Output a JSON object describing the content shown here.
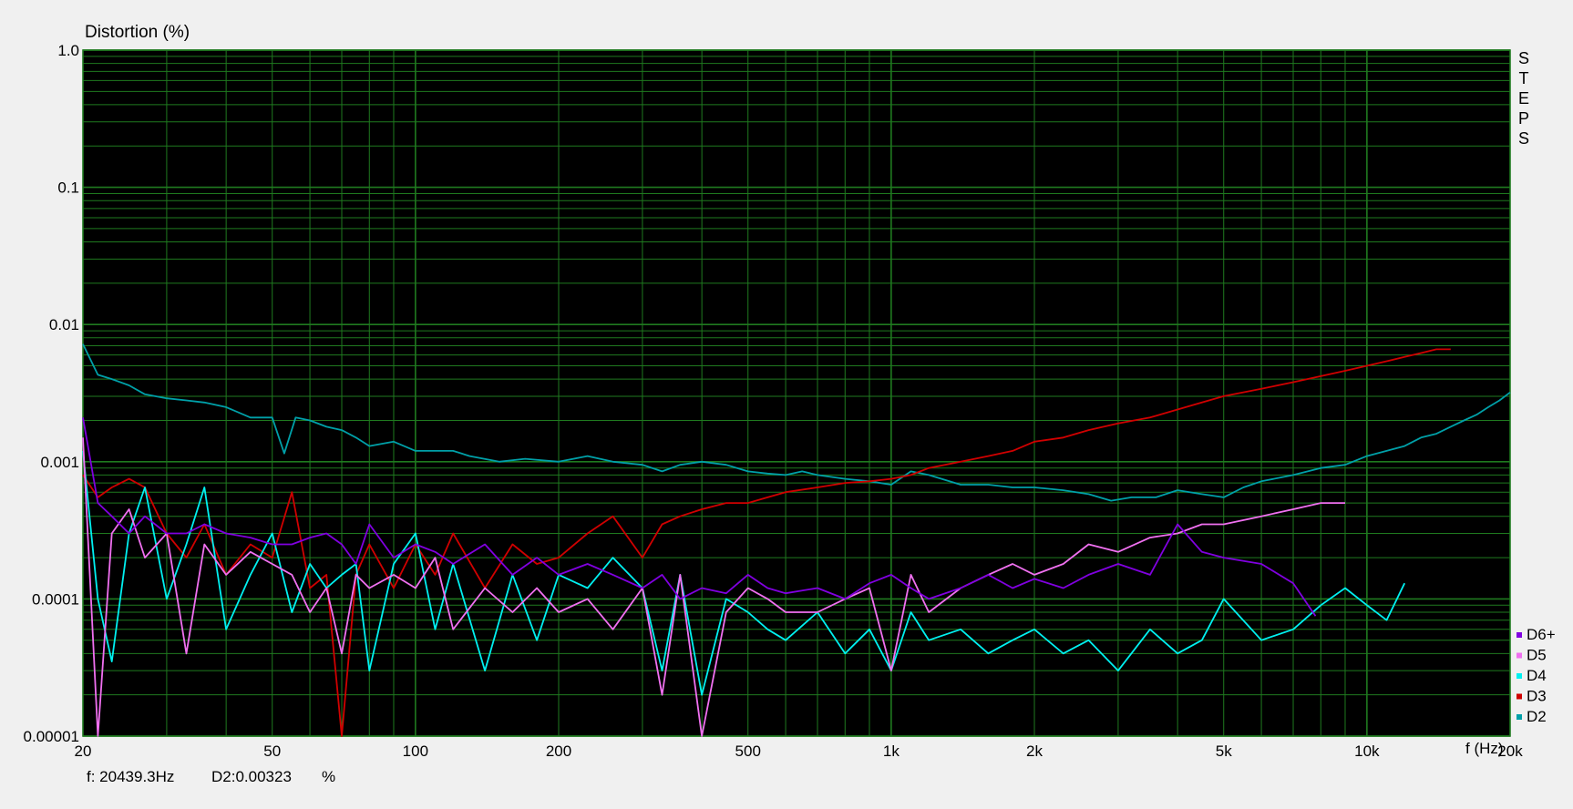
{
  "colors": {
    "plot_background": "#000000",
    "page_background": "#f0f0f0",
    "grid": "#1f7a1f",
    "D2": "#00a0a8",
    "D3": "#d00000",
    "D4": "#00f0f0",
    "D5": "#f070f0",
    "D6+": "#8000e0"
  },
  "chart_data": {
    "type": "line",
    "title": "",
    "ylabel": "Distortion (%)",
    "xlabel": "f (Hz)",
    "x_scale": "log",
    "y_scale": "log",
    "xlim": [
      20,
      20000
    ],
    "ylim": [
      1e-05,
      1.0
    ],
    "grid": true,
    "legend_placement": "right-bottom",
    "side_label": "STEPS",
    "x_ticks": [
      "20",
      "50",
      "100",
      "200",
      "500",
      "1k",
      "2k",
      "5k",
      "10k",
      "20k"
    ],
    "y_ticks": [
      "1.0",
      "0.1",
      "0.01",
      "0.001",
      "0.0001",
      "0.00001"
    ],
    "readout": {
      "frequency": "f: 20439.3Hz",
      "value": "D2:0.00323",
      "unit": "%"
    },
    "legend": [
      "D6+",
      "D5",
      "D4",
      "D3",
      "D2"
    ],
    "series": [
      {
        "name": "D2",
        "x": [
          20,
          21.5,
          23,
          25,
          27,
          30,
          33,
          36,
          40,
          45,
          50,
          53,
          56,
          60,
          65,
          70,
          75,
          80,
          90,
          100,
          110,
          120,
          130,
          150,
          170,
          200,
          230,
          260,
          300,
          330,
          360,
          400,
          450,
          500,
          550,
          600,
          650,
          700,
          800,
          900,
          1000,
          1100,
          1200,
          1400,
          1600,
          1800,
          2000,
          2300,
          2600,
          2900,
          3200,
          3600,
          4000,
          4500,
          5000,
          5500,
          6000,
          7000,
          8000,
          9000,
          10000,
          11000,
          12000,
          13000,
          14000,
          15000,
          16000,
          17000,
          18000,
          19000,
          20000
        ],
        "y": [
          0.0072,
          0.0043,
          0.004,
          0.0036,
          0.0031,
          0.0029,
          0.0028,
          0.0027,
          0.0025,
          0.0021,
          0.0021,
          0.00115,
          0.0021,
          0.002,
          0.0018,
          0.0017,
          0.0015,
          0.0013,
          0.0014,
          0.0012,
          0.0012,
          0.0012,
          0.0011,
          0.001,
          0.00105,
          0.001,
          0.0011,
          0.001,
          0.00095,
          0.00085,
          0.00095,
          0.001,
          0.00095,
          0.00085,
          0.00082,
          0.0008,
          0.00085,
          0.0008,
          0.00075,
          0.00072,
          0.00068,
          0.00085,
          0.0008,
          0.00068,
          0.00068,
          0.00065,
          0.00065,
          0.00062,
          0.00058,
          0.00052,
          0.00055,
          0.00055,
          0.00062,
          0.00058,
          0.00055,
          0.00065,
          0.00072,
          0.0008,
          0.0009,
          0.00095,
          0.0011,
          0.0012,
          0.0013,
          0.0015,
          0.0016,
          0.0018,
          0.002,
          0.0022,
          0.0025,
          0.0028,
          0.0032
        ]
      },
      {
        "name": "D3",
        "x": [
          20,
          21.5,
          23,
          25,
          27,
          30,
          33,
          36,
          40,
          45,
          50,
          55,
          60,
          65,
          70,
          75,
          80,
          90,
          100,
          110,
          120,
          140,
          160,
          180,
          200,
          230,
          260,
          300,
          330,
          360,
          400,
          450,
          500,
          550,
          600,
          700,
          800,
          900,
          1000,
          1100,
          1200,
          1400,
          1600,
          1800,
          2000,
          2300,
          2600,
          3000,
          3500,
          4000,
          4500,
          5000,
          6000,
          7000,
          8000,
          9000,
          10000,
          11000,
          12000,
          13000,
          14000,
          15000
        ],
        "y": [
          0.0008,
          0.00055,
          0.00065,
          0.00075,
          0.00065,
          0.0003,
          0.0002,
          0.00035,
          0.00015,
          0.00025,
          0.0002,
          0.0006,
          0.00012,
          0.00015,
          1e-05,
          0.00015,
          0.00025,
          0.00012,
          0.00025,
          0.00015,
          0.0003,
          0.00012,
          0.00025,
          0.00018,
          0.0002,
          0.0003,
          0.0004,
          0.0002,
          0.00035,
          0.0004,
          0.00045,
          0.0005,
          0.0005,
          0.00055,
          0.0006,
          0.00065,
          0.0007,
          0.00072,
          0.00075,
          0.0008,
          0.0009,
          0.001,
          0.0011,
          0.0012,
          0.0014,
          0.0015,
          0.0017,
          0.0019,
          0.0021,
          0.0024,
          0.0027,
          0.003,
          0.0034,
          0.0038,
          0.0042,
          0.0046,
          0.005,
          0.0054,
          0.0058,
          0.0062,
          0.0066,
          0.0066
        ]
      },
      {
        "name": "D4",
        "x": [
          20,
          21.5,
          23,
          25,
          27,
          30,
          33,
          36,
          40,
          45,
          50,
          55,
          60,
          65,
          70,
          75,
          80,
          90,
          100,
          110,
          120,
          140,
          160,
          180,
          200,
          230,
          260,
          300,
          330,
          360,
          400,
          450,
          500,
          550,
          600,
          700,
          800,
          900,
          1000,
          1100,
          1200,
          1400,
          1600,
          1800,
          2000,
          2300,
          2600,
          3000,
          3500,
          4000,
          4500,
          5000,
          6000,
          7000,
          8000,
          9000,
          10000,
          11000,
          12000
        ],
        "y": [
          0.0012,
          0.0001,
          3.5e-05,
          0.0003,
          0.00065,
          0.0001,
          0.00025,
          0.00065,
          6e-05,
          0.00015,
          0.0003,
          8e-05,
          0.00018,
          0.00012,
          0.00015,
          0.00018,
          3e-05,
          0.00018,
          0.0003,
          6e-05,
          0.00018,
          3e-05,
          0.00015,
          5e-05,
          0.00015,
          0.00012,
          0.0002,
          0.00012,
          3e-05,
          0.00015,
          2e-05,
          0.0001,
          8e-05,
          6e-05,
          5e-05,
          8e-05,
          4e-05,
          6e-05,
          3e-05,
          8e-05,
          5e-05,
          6e-05,
          4e-05,
          5e-05,
          6e-05,
          4e-05,
          5e-05,
          3e-05,
          6e-05,
          4e-05,
          5e-05,
          0.0001,
          5e-05,
          6e-05,
          9e-05,
          0.00012,
          9e-05,
          7e-05,
          0.00013
        ]
      },
      {
        "name": "D5",
        "x": [
          20,
          21.5,
          23,
          25,
          27,
          30,
          33,
          36,
          40,
          45,
          50,
          55,
          60,
          65,
          70,
          75,
          80,
          90,
          100,
          110,
          120,
          140,
          160,
          180,
          200,
          230,
          260,
          300,
          330,
          360,
          400,
          450,
          500,
          550,
          600,
          700,
          800,
          900,
          1000,
          1100,
          1200,
          1400,
          1600,
          1800,
          2000,
          2300,
          2600,
          3000,
          3500,
          4000,
          4500,
          5000,
          6000,
          7000,
          8000,
          9000
        ],
        "y": [
          0.0015,
          1e-05,
          0.0003,
          0.00045,
          0.0002,
          0.0003,
          4e-05,
          0.00025,
          0.00015,
          0.00022,
          0.00018,
          0.00015,
          8e-05,
          0.00012,
          4e-05,
          0.00015,
          0.00012,
          0.00015,
          0.00012,
          0.0002,
          6e-05,
          0.00012,
          8e-05,
          0.00012,
          8e-05,
          0.0001,
          6e-05,
          0.00012,
          2e-05,
          0.00015,
          1e-05,
          8e-05,
          0.00012,
          0.0001,
          8e-05,
          8e-05,
          0.0001,
          0.00012,
          3e-05,
          0.00015,
          8e-05,
          0.00012,
          0.00015,
          0.00018,
          0.00015,
          0.00018,
          0.00025,
          0.00022,
          0.00028,
          0.0003,
          0.00035,
          0.00035,
          0.0004,
          0.00045,
          0.0005,
          0.0005
        ]
      },
      {
        "name": "D6+",
        "x": [
          20,
          21.5,
          23,
          25,
          27,
          30,
          33,
          36,
          40,
          45,
          50,
          55,
          60,
          65,
          70,
          75,
          80,
          90,
          100,
          110,
          120,
          140,
          160,
          180,
          200,
          230,
          260,
          300,
          330,
          360,
          400,
          450,
          500,
          550,
          600,
          700,
          800,
          900,
          1000,
          1100,
          1200,
          1400,
          1600,
          1800,
          2000,
          2300,
          2600,
          3000,
          3500,
          4000,
          4500,
          5000,
          6000,
          7000,
          7800
        ],
        "y": [
          0.0021,
          0.0005,
          0.0004,
          0.0003,
          0.0004,
          0.0003,
          0.0003,
          0.00035,
          0.0003,
          0.00028,
          0.00025,
          0.00025,
          0.00028,
          0.0003,
          0.00025,
          0.00018,
          0.00035,
          0.0002,
          0.00025,
          0.00022,
          0.00018,
          0.00025,
          0.00015,
          0.0002,
          0.00015,
          0.00018,
          0.00015,
          0.00012,
          0.00015,
          0.0001,
          0.00012,
          0.00011,
          0.00015,
          0.00012,
          0.00011,
          0.00012,
          0.0001,
          0.00013,
          0.00015,
          0.00012,
          0.0001,
          0.00012,
          0.00015,
          0.00012,
          0.00014,
          0.00012,
          0.00015,
          0.00018,
          0.00015,
          0.00035,
          0.00022,
          0.0002,
          0.00018,
          0.00013,
          7.5e-05
        ]
      }
    ]
  }
}
